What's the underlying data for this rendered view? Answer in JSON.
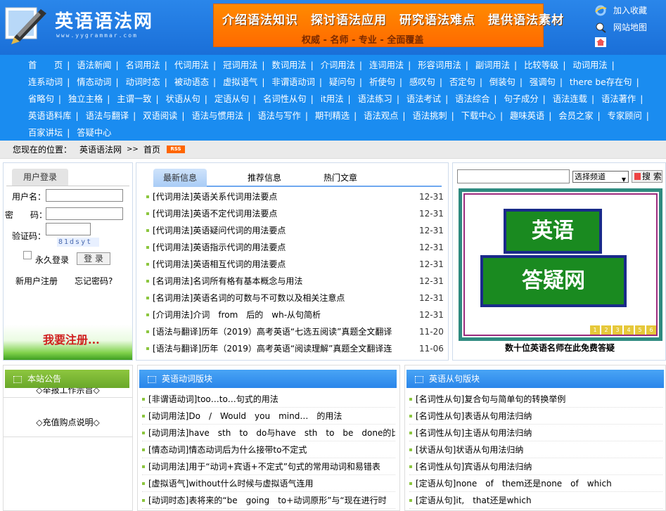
{
  "site": {
    "logo_text": "英语语法网",
    "logo_url": "www.yygrammar.com"
  },
  "banner": {
    "main": "介绍语法知识　探讨语法应用　研究语法难点　提供语法素材",
    "sub": "权威 - 名师 - 专业 - 全面覆盖"
  },
  "top_links": [
    "加入收藏",
    "网站地图"
  ],
  "nav": [
    "首　　页",
    "语法新闻",
    "名词用法",
    "代词用法",
    "冠词用法",
    "数词用法",
    "介词用法",
    "连词用法",
    "形容词用法",
    "副词用法",
    "比较等级",
    "动词用法",
    "连系动词",
    "情态动词",
    "动词时态",
    "被动语态",
    "虚拟语气",
    "非谓语动词",
    "疑问句",
    "祈使句",
    "感叹句",
    "否定句",
    "倒装句",
    "强调句",
    "there be存在句",
    "省略句",
    "独立主格",
    "主谓一致",
    "状语从句",
    "定语从句",
    "名词性从句",
    "it用法",
    "语法练习",
    "语法考试",
    "语法综合",
    "句子成分",
    "语法连载",
    "语法著作",
    "英语语料库",
    "语法与翻译",
    "双语阅读",
    "语法与惯用法",
    "语法与写作",
    "期刊精选",
    "语法观点",
    "语法挑刺",
    "下载中心",
    "趣味英语",
    "会员之家",
    "专家顾问",
    "百家讲坛",
    "答疑中心"
  ],
  "breadcrumb": {
    "label": "您现在的位置：",
    "site": "英语语法网",
    "sep": ">>",
    "page": "首页",
    "rss": "RSS"
  },
  "login": {
    "tab": "用户登录",
    "username": "用户名：",
    "password": "密　　码：",
    "captcha_label": "验证码：",
    "captcha": "81dsyt",
    "remember": "永久登录",
    "submit": "登 录",
    "register": "新用户注册",
    "forgot": "忘记密码?",
    "banner": "我要注册..."
  },
  "news": {
    "tabs": [
      "最新信息",
      "推荐信息",
      "热门文章"
    ],
    "items": [
      {
        "t": "[代词用法]英语关系代词用法要点",
        "d": "12-31"
      },
      {
        "t": "[代词用法]英语不定代词用法要点",
        "d": "12-31"
      },
      {
        "t": "[代词用法]英语疑问代词的用法要点",
        "d": "12-31"
      },
      {
        "t": "[代词用法]英语指示代词的用法要点",
        "d": "12-31"
      },
      {
        "t": "[代词用法]英语相互代词的用法要点",
        "d": "12-31"
      },
      {
        "t": "[名词用法]名词所有格有基本概念与用法",
        "d": "12-31"
      },
      {
        "t": "[名词用法]英语名词的可数与不可数以及相关注意点",
        "d": "12-31"
      },
      {
        "t": "[介词用法]介词　from　后的　wh-从句简析",
        "d": "12-31"
      },
      {
        "t": "[语法与翻译]历年（2019）高考英语“七选五阅读”真题全文翻译",
        "d": "11-20"
      },
      {
        "t": "[语法与翻译]历年（2019）高考英语“阅读理解”真题全文翻译连",
        "d": "11-06"
      }
    ]
  },
  "search": {
    "select": "选择频道",
    "button": "搜 索"
  },
  "qa": {
    "line1": "英语",
    "line2": "答疑网",
    "nums": [
      "1",
      "2",
      "3",
      "4",
      "5",
      "6"
    ],
    "caption": "数十位英语名师在此免费答疑"
  },
  "notice": {
    "title": "本站公告",
    "items": [
      "◇举报工作宗旨◇",
      "◇充值购点说明◇"
    ]
  },
  "verbs": {
    "title": "英语动词版块",
    "items": [
      "[非谓语动词]too…to…句式的用法",
      "[动词用法]Do　/　Would　you　mind…　的用法",
      "[动词用法]have　sth　to　do与have　sth　to　be　done的比较",
      "[情态动词]情态动词后为什么接带to不定式",
      "[动词用法]用于“动词+宾语+不定式”句式的常用动词和易错表",
      "[虚拟语气]without什么时候与虚拟语气连用",
      "[动词时态]表将来的“be　going　to+动词原形”与“现在进行时"
    ]
  },
  "clauses": {
    "title": "英语从句版块",
    "items": [
      "[名词性从句]复合句与简单句的转换举例",
      "[名词性从句]表语从句用法归纳",
      "[名词性从句]主语从句用法归纳",
      "[状语从句]状语从句用法归纳",
      "[名词性从句]宾语从句用法归纳",
      "[定语从句]none　of　them还是none　of　which",
      "[定语从句]it,　that还是which"
    ]
  }
}
